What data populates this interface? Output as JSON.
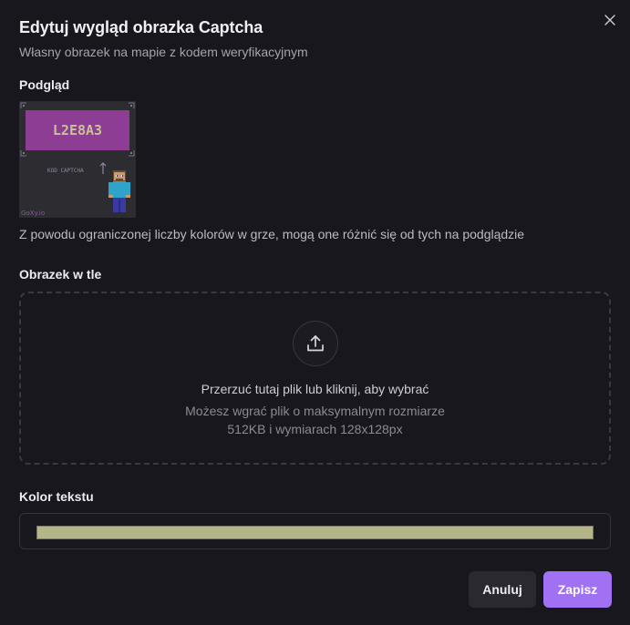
{
  "dialog": {
    "title": "Edytuj wygląd obrazka Captcha",
    "subtitle": "Własny obrazek na mapie z kodem weryfikacyjnym"
  },
  "preview": {
    "label": "Podgląd",
    "captcha_code": "L2E8A3",
    "caption": "KOD CAPTCHA",
    "watermark": "GoXy.io",
    "note": "Z powodu ograniczonej liczby kolorów w grze, mogą one różnić się od tych na podglądzie"
  },
  "background": {
    "label": "Obrazek w tle",
    "drop_main": "Przerzuć tutaj plik lub kliknij, aby wybrać",
    "drop_sub_line1": "Możesz wgrać plik o maksymalnym rozmiarze",
    "drop_sub_line2": "512KB i wymiarach 128x128px",
    "icon": "upload-icon"
  },
  "text_color": {
    "label": "Kolor tekstu",
    "value": "#b5b58a"
  },
  "buttons": {
    "cancel": "Anuluj",
    "save": "Zapisz"
  },
  "colors": {
    "accent": "#a071f2",
    "background": "#18171d",
    "captcha_box": "#8e3d95"
  }
}
